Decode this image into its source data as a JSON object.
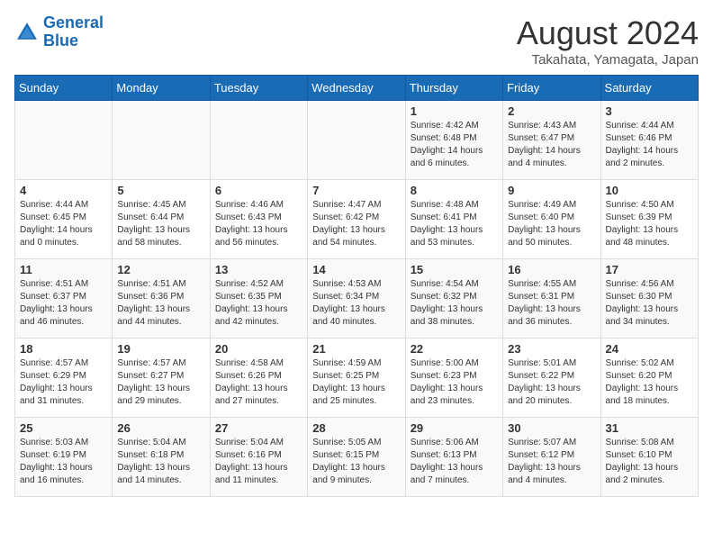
{
  "header": {
    "logo_line1": "General",
    "logo_line2": "Blue",
    "month_year": "August 2024",
    "location": "Takahata, Yamagata, Japan"
  },
  "weekdays": [
    "Sunday",
    "Monday",
    "Tuesday",
    "Wednesday",
    "Thursday",
    "Friday",
    "Saturday"
  ],
  "weeks": [
    [
      {
        "day": "",
        "info": ""
      },
      {
        "day": "",
        "info": ""
      },
      {
        "day": "",
        "info": ""
      },
      {
        "day": "",
        "info": ""
      },
      {
        "day": "1",
        "info": "Sunrise: 4:42 AM\nSunset: 6:48 PM\nDaylight: 14 hours\nand 6 minutes."
      },
      {
        "day": "2",
        "info": "Sunrise: 4:43 AM\nSunset: 6:47 PM\nDaylight: 14 hours\nand 4 minutes."
      },
      {
        "day": "3",
        "info": "Sunrise: 4:44 AM\nSunset: 6:46 PM\nDaylight: 14 hours\nand 2 minutes."
      }
    ],
    [
      {
        "day": "4",
        "info": "Sunrise: 4:44 AM\nSunset: 6:45 PM\nDaylight: 14 hours\nand 0 minutes."
      },
      {
        "day": "5",
        "info": "Sunrise: 4:45 AM\nSunset: 6:44 PM\nDaylight: 13 hours\nand 58 minutes."
      },
      {
        "day": "6",
        "info": "Sunrise: 4:46 AM\nSunset: 6:43 PM\nDaylight: 13 hours\nand 56 minutes."
      },
      {
        "day": "7",
        "info": "Sunrise: 4:47 AM\nSunset: 6:42 PM\nDaylight: 13 hours\nand 54 minutes."
      },
      {
        "day": "8",
        "info": "Sunrise: 4:48 AM\nSunset: 6:41 PM\nDaylight: 13 hours\nand 53 minutes."
      },
      {
        "day": "9",
        "info": "Sunrise: 4:49 AM\nSunset: 6:40 PM\nDaylight: 13 hours\nand 50 minutes."
      },
      {
        "day": "10",
        "info": "Sunrise: 4:50 AM\nSunset: 6:39 PM\nDaylight: 13 hours\nand 48 minutes."
      }
    ],
    [
      {
        "day": "11",
        "info": "Sunrise: 4:51 AM\nSunset: 6:37 PM\nDaylight: 13 hours\nand 46 minutes."
      },
      {
        "day": "12",
        "info": "Sunrise: 4:51 AM\nSunset: 6:36 PM\nDaylight: 13 hours\nand 44 minutes."
      },
      {
        "day": "13",
        "info": "Sunrise: 4:52 AM\nSunset: 6:35 PM\nDaylight: 13 hours\nand 42 minutes."
      },
      {
        "day": "14",
        "info": "Sunrise: 4:53 AM\nSunset: 6:34 PM\nDaylight: 13 hours\nand 40 minutes."
      },
      {
        "day": "15",
        "info": "Sunrise: 4:54 AM\nSunset: 6:32 PM\nDaylight: 13 hours\nand 38 minutes."
      },
      {
        "day": "16",
        "info": "Sunrise: 4:55 AM\nSunset: 6:31 PM\nDaylight: 13 hours\nand 36 minutes."
      },
      {
        "day": "17",
        "info": "Sunrise: 4:56 AM\nSunset: 6:30 PM\nDaylight: 13 hours\nand 34 minutes."
      }
    ],
    [
      {
        "day": "18",
        "info": "Sunrise: 4:57 AM\nSunset: 6:29 PM\nDaylight: 13 hours\nand 31 minutes."
      },
      {
        "day": "19",
        "info": "Sunrise: 4:57 AM\nSunset: 6:27 PM\nDaylight: 13 hours\nand 29 minutes."
      },
      {
        "day": "20",
        "info": "Sunrise: 4:58 AM\nSunset: 6:26 PM\nDaylight: 13 hours\nand 27 minutes."
      },
      {
        "day": "21",
        "info": "Sunrise: 4:59 AM\nSunset: 6:25 PM\nDaylight: 13 hours\nand 25 minutes."
      },
      {
        "day": "22",
        "info": "Sunrise: 5:00 AM\nSunset: 6:23 PM\nDaylight: 13 hours\nand 23 minutes."
      },
      {
        "day": "23",
        "info": "Sunrise: 5:01 AM\nSunset: 6:22 PM\nDaylight: 13 hours\nand 20 minutes."
      },
      {
        "day": "24",
        "info": "Sunrise: 5:02 AM\nSunset: 6:20 PM\nDaylight: 13 hours\nand 18 minutes."
      }
    ],
    [
      {
        "day": "25",
        "info": "Sunrise: 5:03 AM\nSunset: 6:19 PM\nDaylight: 13 hours\nand 16 minutes."
      },
      {
        "day": "26",
        "info": "Sunrise: 5:04 AM\nSunset: 6:18 PM\nDaylight: 13 hours\nand 14 minutes."
      },
      {
        "day": "27",
        "info": "Sunrise: 5:04 AM\nSunset: 6:16 PM\nDaylight: 13 hours\nand 11 minutes."
      },
      {
        "day": "28",
        "info": "Sunrise: 5:05 AM\nSunset: 6:15 PM\nDaylight: 13 hours\nand 9 minutes."
      },
      {
        "day": "29",
        "info": "Sunrise: 5:06 AM\nSunset: 6:13 PM\nDaylight: 13 hours\nand 7 minutes."
      },
      {
        "day": "30",
        "info": "Sunrise: 5:07 AM\nSunset: 6:12 PM\nDaylight: 13 hours\nand 4 minutes."
      },
      {
        "day": "31",
        "info": "Sunrise: 5:08 AM\nSunset: 6:10 PM\nDaylight: 13 hours\nand 2 minutes."
      }
    ]
  ]
}
